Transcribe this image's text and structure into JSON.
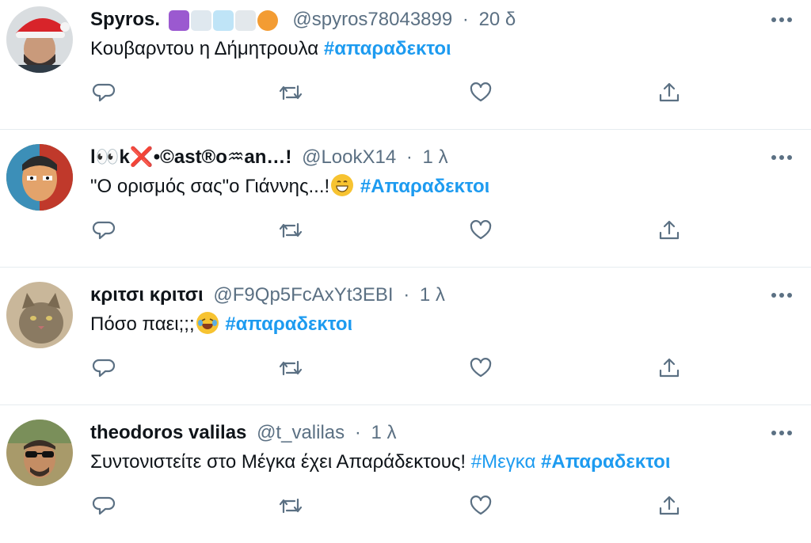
{
  "tweets": [
    {
      "name": "Spyros.",
      "handle": "@spyros78043899",
      "time": "20 δ",
      "text": "Κουβαρντου η Δήμητρουλα",
      "hashtag": "#απαραδεκτοι",
      "header_emojis": [
        "cancer-sign-emoji",
        "snow-cloud-emoji",
        "snowflake-emoji",
        "thunder-cloud-emoji",
        "planet-emoji"
      ]
    },
    {
      "name": "l👀k❌•©ast®o♒an…!",
      "handle": "@LookX14",
      "time": "1 λ",
      "text": "\"Ο ορισμός σας\"ο Γιάννης...!",
      "hashtag": "#Απαραδεκτοι"
    },
    {
      "name": "κριτσι κριτσι",
      "handle": "@F9Qp5FcAxYt3EBI",
      "time": "1 λ",
      "text": "Πόσο παει;;;",
      "hashtag": "#απαραδεκτοι"
    },
    {
      "name": "theodoros valilas",
      "handle": "@t_valilas",
      "time": "1 λ",
      "text": "Συντονιστείτε στο Μέγκα έχει Απαράδεκτους!",
      "hashtag_plain": "#Μεγκα",
      "hashtag": "#Απαραδεκτοι"
    }
  ],
  "dot": "·",
  "colors": {
    "link": "#1d9bf0",
    "muted": "#5b7083",
    "divider": "#e6ecf0"
  }
}
